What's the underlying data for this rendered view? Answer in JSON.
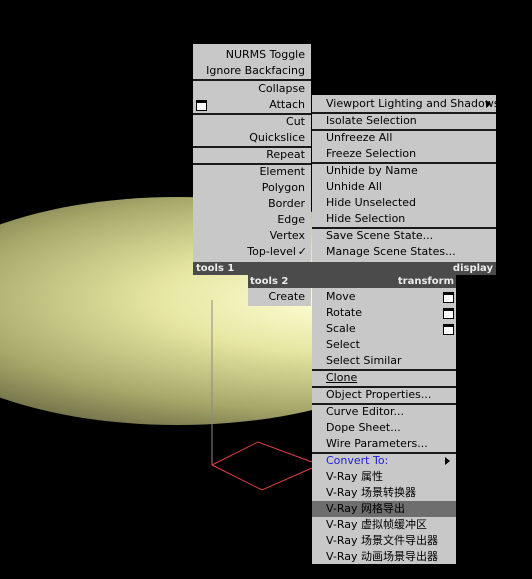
{
  "colors": {
    "menu_bg": "#c8c8c8",
    "bar_bg": "#4b4b4b",
    "highlight": "#6e6e6e",
    "convert_to": "#1d1dd8",
    "wire": "#e04040"
  },
  "quad1": {
    "items": [
      "NURMS Toggle",
      "Ignore Backfacing",
      "Collapse",
      "Attach",
      "Cut",
      "Quickslice",
      "Repeat",
      "Element",
      "Polygon",
      "Border",
      "Edge",
      "Vertex",
      "Top-level"
    ],
    "checkmark": "✓",
    "label": "tools 1"
  },
  "quad2": {
    "label": "display",
    "items": [
      "Viewport Lighting and Shadows",
      "Isolate Selection",
      "Unfreeze All",
      "Freeze Selection",
      "Unhide by Name",
      "Unhide All",
      "Hide Unselected",
      "Hide Selection",
      "Save Scene State...",
      "Manage Scene States..."
    ]
  },
  "quad3": {
    "label": "tools 2",
    "items": [
      "Create"
    ]
  },
  "quad4": {
    "label": "transform",
    "items": [
      "Move",
      "Rotate",
      "Scale",
      "Select",
      "Select Similar",
      "Clone",
      "Object Properties...",
      "Curve Editor...",
      "Dope Sheet...",
      "Wire Parameters...",
      "Convert To:",
      "V-Ray 属性",
      "V-Ray 场景转换器",
      "V-Ray 网格导出",
      "V-Ray 虚拟帧缓冲区",
      "V-Ray 场景文件导出器",
      "V-Ray 动画场景导出器"
    ]
  },
  "icons": [
    "attach-settings-icon",
    "move-settings-icon",
    "rotate-settings-icon",
    "scale-settings-icon",
    "submenu-arrow-icon",
    "checkmark-icon"
  ]
}
